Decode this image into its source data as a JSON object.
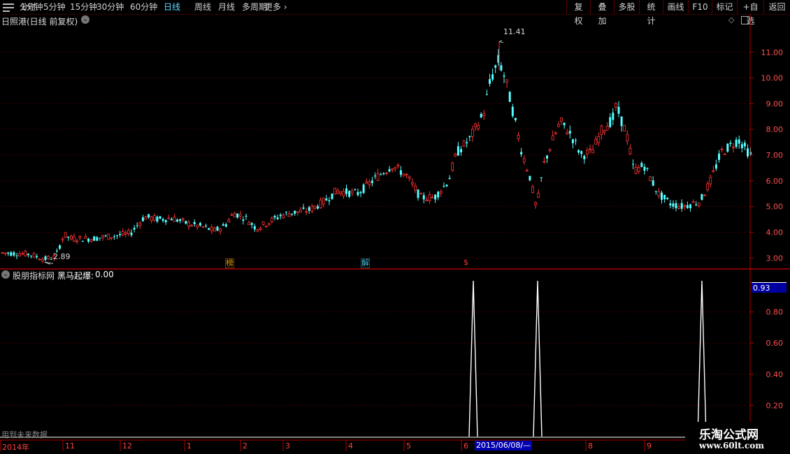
{
  "toolbar": {
    "periods": [
      "分时",
      "1分钟",
      "5分钟",
      "15分钟",
      "30分钟",
      "60分钟",
      "日线",
      "周线",
      "月线",
      "多周期",
      "更多"
    ],
    "active_period": "日线",
    "right_buttons": [
      "复权",
      "叠加",
      "多股",
      "统计",
      "画线",
      "F10",
      "标记",
      "+自选",
      "返回"
    ]
  },
  "main_chart": {
    "title": "日照港(日线 前复权)",
    "max_label": "11.41",
    "min_label": "2.89",
    "markers": [
      {
        "text": "榜",
        "color": "#e0a000"
      },
      {
        "text": "解",
        "color": "#40c0e0"
      },
      {
        "text": "$",
        "color": "#ff3030"
      }
    ]
  },
  "indicator": {
    "title": "股朋指标网",
    "series_label": "黑马起爆:",
    "series_value": "0.00",
    "current_badge": "0.93",
    "footer_note": "用到未来数据"
  },
  "dates": {
    "year_label": "2014年",
    "month_labels": [
      "11",
      "12",
      "1",
      "2",
      "3",
      "4",
      "5",
      "6",
      "8",
      "9"
    ],
    "cursor_date": "2015/06/08/—"
  },
  "watermark": {
    "line1": "乐淘公式网",
    "line2": "www.60lt.com"
  },
  "colors": {
    "up": "#ff3232",
    "down": "#54ffff",
    "grid": "#6e0000",
    "axis": "#b00000",
    "signal": "#ffffff"
  },
  "chart_data": [
    {
      "type": "candlestick",
      "title": "日照港(日线 前复权)",
      "ylim": [
        2.6,
        12.0
      ],
      "y_ticks": [
        3.0,
        4.0,
        5.0,
        6.0,
        7.0,
        8.0,
        9.0,
        10.0,
        11.0
      ],
      "y_tick_labels": [
        "3.00",
        "4.00",
        "5.00",
        "6.00",
        "7.00",
        "8.00",
        "9.00",
        "10.00",
        "11.00"
      ],
      "price_path_anchors": [
        [
          0,
          3.2
        ],
        [
          40,
          3.15
        ],
        [
          62,
          2.95
        ],
        [
          78,
          3.05
        ],
        [
          90,
          3.9
        ],
        [
          100,
          3.75
        ],
        [
          130,
          3.75
        ],
        [
          160,
          3.85
        ],
        [
          185,
          3.95
        ],
        [
          205,
          4.6
        ],
        [
          225,
          4.5
        ],
        [
          245,
          4.55
        ],
        [
          265,
          4.35
        ],
        [
          290,
          4.2
        ],
        [
          305,
          4.05
        ],
        [
          320,
          4.25
        ],
        [
          333,
          4.75
        ],
        [
          350,
          4.55
        ],
        [
          365,
          4.15
        ],
        [
          380,
          4.35
        ],
        [
          400,
          4.65
        ],
        [
          415,
          4.75
        ],
        [
          440,
          4.85
        ],
        [
          460,
          5.15
        ],
        [
          480,
          5.6
        ],
        [
          510,
          5.5
        ],
        [
          540,
          6.2
        ],
        [
          560,
          6.6
        ],
        [
          580,
          6.2
        ],
        [
          600,
          5.35
        ],
        [
          620,
          5.35
        ],
        [
          640,
          6.0
        ],
        [
          652,
          7.1
        ],
        [
          670,
          7.6
        ],
        [
          690,
          8.6
        ],
        [
          700,
          9.9
        ],
        [
          712,
          10.7
        ],
        [
          722,
          9.9
        ],
        [
          733,
          8.6
        ],
        [
          745,
          7.1
        ],
        [
          756,
          6.2
        ],
        [
          766,
          4.9
        ],
        [
          776,
          6.6
        ],
        [
          788,
          7.5
        ],
        [
          800,
          8.3
        ],
        [
          815,
          7.8
        ],
        [
          830,
          7.0
        ],
        [
          845,
          7.1
        ],
        [
          860,
          8.0
        ],
        [
          875,
          8.4
        ],
        [
          880,
          8.9
        ],
        [
          895,
          7.8
        ],
        [
          905,
          6.4
        ],
        [
          920,
          6.6
        ],
        [
          940,
          5.5
        ],
        [
          958,
          5.1
        ],
        [
          975,
          5.0
        ],
        [
          1000,
          5.2
        ],
        [
          1015,
          6.0
        ],
        [
          1030,
          7.1
        ],
        [
          1055,
          7.6
        ],
        [
          1075,
          6.9
        ]
      ],
      "max": {
        "value": 11.41
      },
      "min": {
        "value": 2.89
      }
    },
    {
      "type": "line",
      "series": [
        {
          "name": "黑马起爆",
          "values": [
            0,
            0,
            1,
            0,
            0,
            1,
            0,
            0,
            1,
            0
          ]
        }
      ],
      "ylim": [
        0,
        1.0
      ],
      "y_ticks": [
        0.2,
        0.4,
        0.6,
        0.8
      ],
      "y_tick_labels": [
        "0.20",
        "0.40",
        "0.60",
        "0.80"
      ]
    }
  ]
}
